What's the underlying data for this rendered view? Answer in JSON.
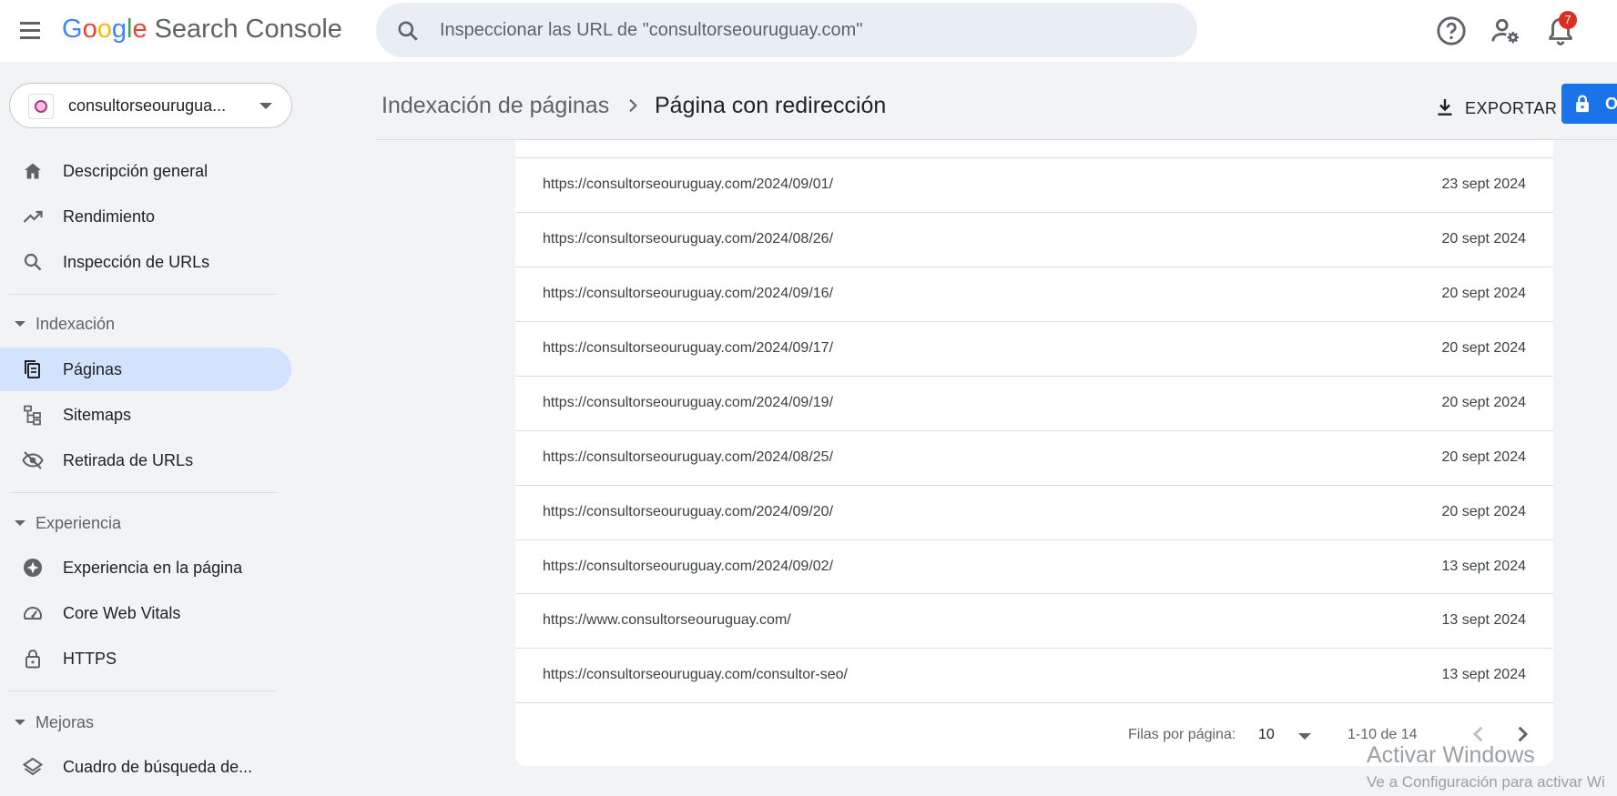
{
  "app": {
    "logo_letters": [
      "G",
      "o",
      "o",
      "g",
      "l",
      "e"
    ],
    "product": "Search Console"
  },
  "search": {
    "placeholder": "Inspeccionar las URL de \"consultorseouruguay.com\""
  },
  "topbar": {
    "notifications_count": "7",
    "icons": [
      "help-icon",
      "manage-users-icon",
      "notifications-icon"
    ]
  },
  "property": {
    "name": "consultorseourugua..."
  },
  "sidebar": {
    "items": [
      {
        "label": "Descripción general",
        "icon": "home-icon"
      },
      {
        "label": "Rendimiento",
        "icon": "trending-up-icon"
      },
      {
        "label": "Inspección de URLs",
        "icon": "search-icon"
      }
    ],
    "sections": [
      {
        "label": "Indexación",
        "items": [
          {
            "label": "Páginas",
            "icon": "pages-icon",
            "active": true
          },
          {
            "label": "Sitemaps",
            "icon": "sitemap-icon"
          },
          {
            "label": "Retirada de URLs",
            "icon": "eye-off-icon"
          }
        ]
      },
      {
        "label": "Experiencia",
        "items": [
          {
            "label": "Experiencia en la página",
            "icon": "page-experience-icon"
          },
          {
            "label": "Core Web Vitals",
            "icon": "gauge-icon"
          },
          {
            "label": "HTTPS",
            "icon": "lock-icon"
          }
        ]
      },
      {
        "label": "Mejoras",
        "items": [
          {
            "label": "Cuadro de búsqueda de...",
            "icon": "layers-icon"
          }
        ]
      }
    ]
  },
  "breadcrumb": {
    "parent": "Indexación de páginas",
    "current": "Página con redirección"
  },
  "actions": {
    "export_label": "EXPORTAR",
    "open_label": "O"
  },
  "table": {
    "rows": [
      {
        "url": "https://consultorseouruguay.com/2024/09/01/",
        "date": "23 sept 2024"
      },
      {
        "url": "https://consultorseouruguay.com/2024/08/26/",
        "date": "20 sept 2024"
      },
      {
        "url": "https://consultorseouruguay.com/2024/09/16/",
        "date": "20 sept 2024"
      },
      {
        "url": "https://consultorseouruguay.com/2024/09/17/",
        "date": "20 sept 2024"
      },
      {
        "url": "https://consultorseouruguay.com/2024/09/19/",
        "date": "20 sept 2024"
      },
      {
        "url": "https://consultorseouruguay.com/2024/08/25/",
        "date": "20 sept 2024"
      },
      {
        "url": "https://consultorseouruguay.com/2024/09/20/",
        "date": "20 sept 2024"
      },
      {
        "url": "https://consultorseouruguay.com/2024/09/02/",
        "date": "13 sept 2024"
      },
      {
        "url": "https://www.consultorseouruguay.com/",
        "date": "13 sept 2024"
      },
      {
        "url": "https://consultorseouruguay.com/consultor-seo/",
        "date": "13 sept 2024"
      }
    ]
  },
  "pagination": {
    "rows_per_page_label": "Filas por página:",
    "rows_per_page": "10",
    "range": "1-10 de 14"
  },
  "watermark": {
    "line1": "Activar Windows",
    "line2": "Ve a Configuración para activar Wi"
  },
  "colors": {
    "accent": "#1a73e8",
    "active_nav": "#d3e3fd",
    "badge": "#d93025",
    "background": "#f1f3f4"
  }
}
